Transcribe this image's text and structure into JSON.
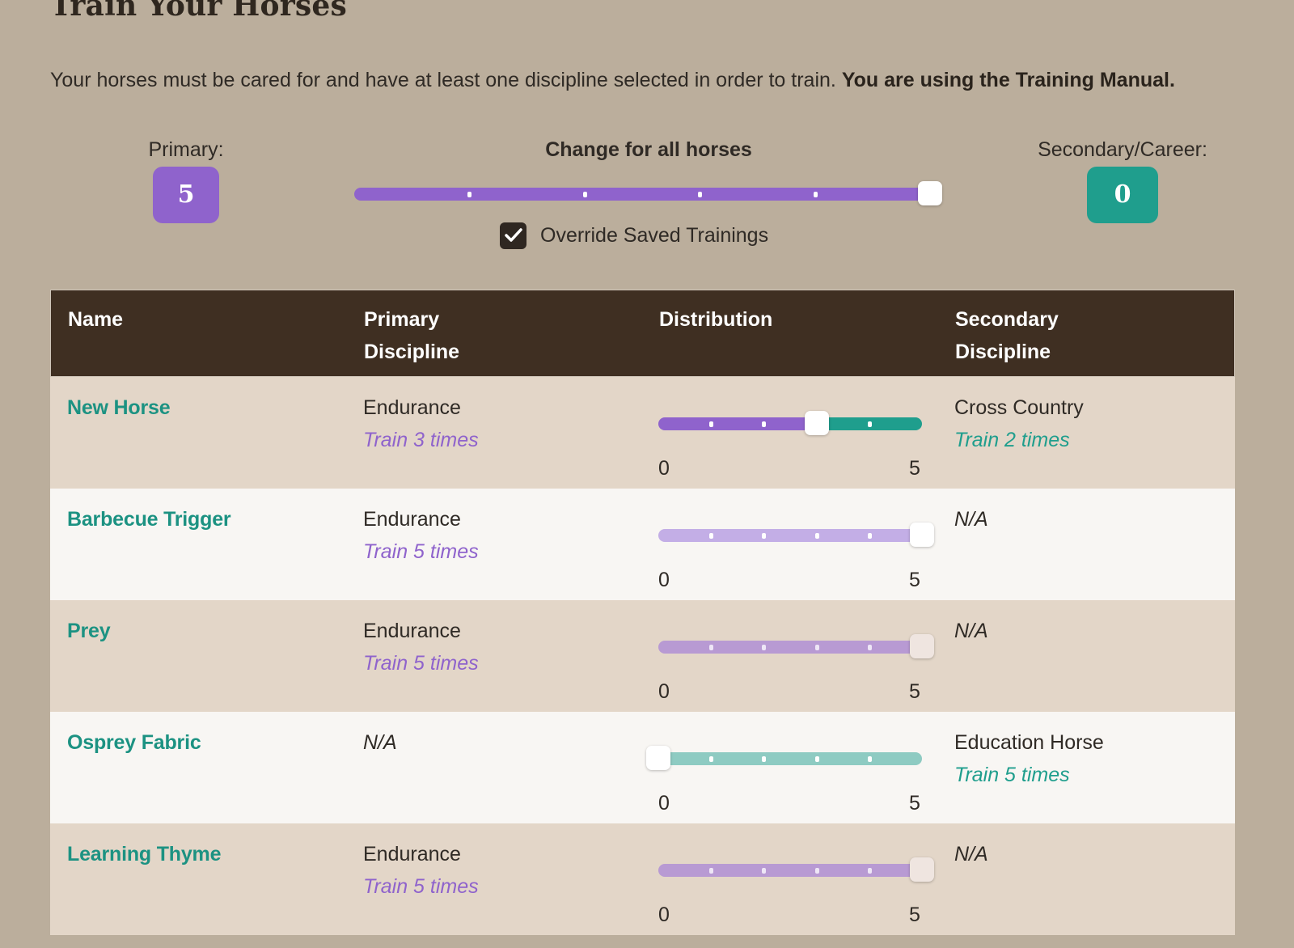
{
  "title": "Train Your Horses",
  "intro": {
    "text": "Your horses must be cared for and have at least one discipline selected in order to train.",
    "bold": "You are using the Training Manual."
  },
  "primary": {
    "label": "Primary:",
    "value": "5",
    "color": "#8f63cc"
  },
  "secondary": {
    "label": "Secondary/Career:",
    "value": "0",
    "color": "#1f9e8d"
  },
  "global": {
    "title": "Change for all horses",
    "value": 5,
    "max": 5,
    "override_label": "Override Saved Trainings",
    "override_checked": true
  },
  "table": {
    "headers": {
      "name": "Name",
      "primary_line1": "Primary",
      "primary_line2": "Discipline",
      "distribution": "Distribution",
      "secondary_line1": "Secondary",
      "secondary_line2": "Discipline"
    },
    "min_label": "0",
    "max_label": "5",
    "rows": [
      {
        "name": "New Horse",
        "primary": "Endurance",
        "primary_train": "Train 3 times",
        "value": 3,
        "secondary": "Cross Country",
        "secondary_train": "Train 2 times",
        "primary_na": false,
        "secondary_na": false
      },
      {
        "name": "Barbecue Trigger",
        "primary": "Endurance",
        "primary_train": "Train 5 times",
        "value": 5,
        "secondary": "N/A",
        "secondary_train": "",
        "primary_na": false,
        "secondary_na": true
      },
      {
        "name": "Prey",
        "primary": "Endurance",
        "primary_train": "Train 5 times",
        "value": 5,
        "secondary": "N/A",
        "secondary_train": "",
        "primary_na": false,
        "secondary_na": true
      },
      {
        "name": "Osprey Fabric",
        "primary": "N/A",
        "primary_train": "",
        "value": 0,
        "secondary": "Education Horse",
        "secondary_train": "Train 5 times",
        "primary_na": true,
        "secondary_na": false
      },
      {
        "name": "Learning Thyme",
        "primary": "Endurance",
        "primary_train": "Train 5 times",
        "value": 5,
        "secondary": "N/A",
        "secondary_train": "",
        "primary_na": false,
        "secondary_na": true
      }
    ]
  }
}
